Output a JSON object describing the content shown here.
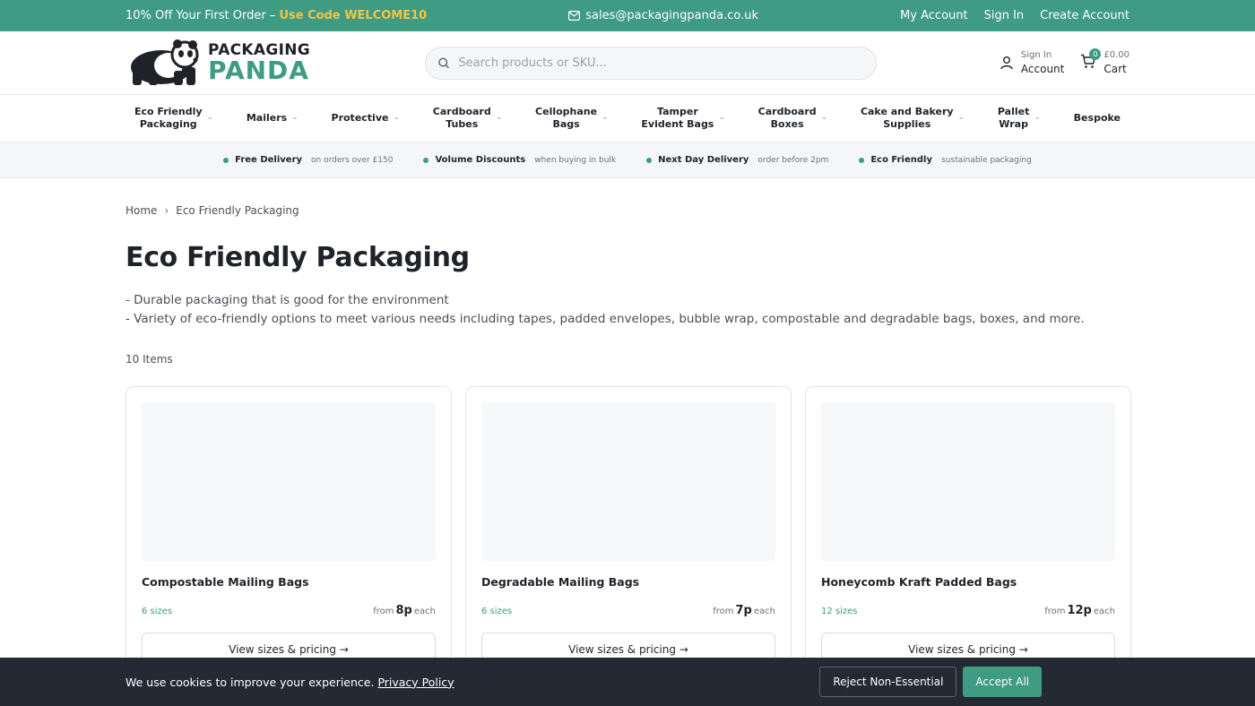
{
  "topbar": {
    "promo_text": "10% Off Your First Order – ",
    "promo_code": "Use Code WELCOME10",
    "email": "sales@packagingpanda.co.uk",
    "links": [
      "My Account",
      "Sign In",
      "Create Account"
    ]
  },
  "header": {
    "logo_line1": "PACKAGING",
    "logo_line2": "PANDA",
    "search_placeholder": "Search products or SKU...",
    "account_small": "Sign In",
    "account_label": "Account",
    "cart_total": "£0.00",
    "cart_label": "Cart",
    "cart_count": "0"
  },
  "nav": {
    "items": [
      {
        "line1": "Eco Friendly",
        "line2": "Packaging",
        "dropdown": true
      },
      {
        "line1": "Mailers",
        "line2": "",
        "dropdown": true
      },
      {
        "line1": "Protective",
        "line2": "",
        "dropdown": true
      },
      {
        "line1": "Cardboard",
        "line2": "Tubes",
        "dropdown": true
      },
      {
        "line1": "Cellophane",
        "line2": "Bags",
        "dropdown": true
      },
      {
        "line1": "Tamper",
        "line2": "Evident Bags",
        "dropdown": true
      },
      {
        "line1": "Cardboard",
        "line2": "Boxes",
        "dropdown": true
      },
      {
        "line1": "Cake and Bakery",
        "line2": "Supplies",
        "dropdown": true
      },
      {
        "line1": "Pallet",
        "line2": "Wrap",
        "dropdown": true
      },
      {
        "line1": "Bespoke",
        "line2": "",
        "dropdown": false
      }
    ]
  },
  "benefits": [
    {
      "title": "Free Delivery",
      "sub": "on orders over £150"
    },
    {
      "title": "Volume Discounts",
      "sub": "when buying in bulk"
    },
    {
      "title": "Next Day Delivery",
      "sub": "order before 2pm"
    },
    {
      "title": "Eco Friendly",
      "sub": "sustainable packaging"
    }
  ],
  "breadcrumb": {
    "home": "Home",
    "sep": "›",
    "current": "Eco Friendly Packaging"
  },
  "page_title": "Eco Friendly Packaging",
  "description": [
    "- Durable packaging that is good for the environment",
    "- Variety of eco-friendly options to meet various needs including tapes, padded envelopes, bubble wrap, compostable and degradable bags, boxes, and more."
  ],
  "item_count": "10 Items",
  "products": [
    {
      "name": "Compostable Mailing Bags",
      "sizes": "6 sizes",
      "from": "from",
      "price": "8p",
      "each": "each",
      "button": "View sizes & pricing →"
    },
    {
      "name": "Degradable Mailing Bags",
      "sizes": "6 sizes",
      "from": "from",
      "price": "7p",
      "each": "each",
      "button": "View sizes & pricing →"
    },
    {
      "name": "Honeycomb Kraft Padded Bags",
      "sizes": "12 sizes",
      "from": "from",
      "price": "12p",
      "each": "each",
      "button": "View sizes & pricing →"
    }
  ],
  "cookie": {
    "message": "We use cookies to improve your experience. ",
    "policy_link": "Privacy Policy",
    "reject_label": "Reject Non-Essential",
    "accept_label": "Accept All"
  },
  "colors": {
    "brand": "#3f9b82",
    "promo_code": "#f6c443",
    "cookie_bg": "#232a33"
  }
}
